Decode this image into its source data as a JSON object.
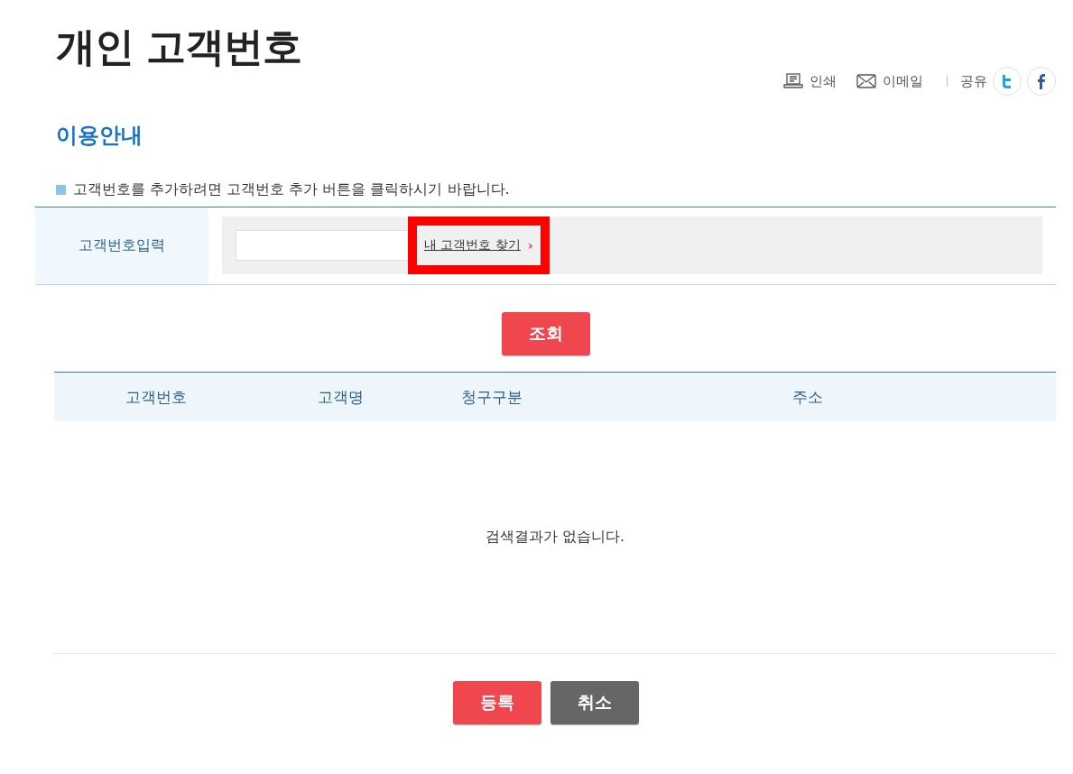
{
  "page_title": "개인 고객번호",
  "tools": [
    {
      "kind": "print",
      "label": "인쇄"
    },
    {
      "kind": "email",
      "label": "이메일"
    }
  ],
  "share": {
    "label": "공유",
    "networks": [
      {
        "kind": "twitter"
      },
      {
        "kind": "facebook"
      }
    ]
  },
  "section_title": "이용안내",
  "notice": "고객번호를 추가하려면 고객번호 추가 버튼을 클릭하시기 바랍니다.",
  "form": {
    "label": "고객번호입력",
    "find_link": {
      "label": "내 고객번호 찾기",
      "arrow": "›",
      "highlighted": true
    }
  },
  "search_button": "조회",
  "table": {
    "columns": [
      "고객번호",
      "고객명",
      "청구구분",
      "주소"
    ],
    "empty_message": "검색결과가 없습니다."
  },
  "buttons": [
    {
      "kind": "primary",
      "label": "등록"
    },
    {
      "kind": "secondary",
      "label": "취소"
    }
  ]
}
